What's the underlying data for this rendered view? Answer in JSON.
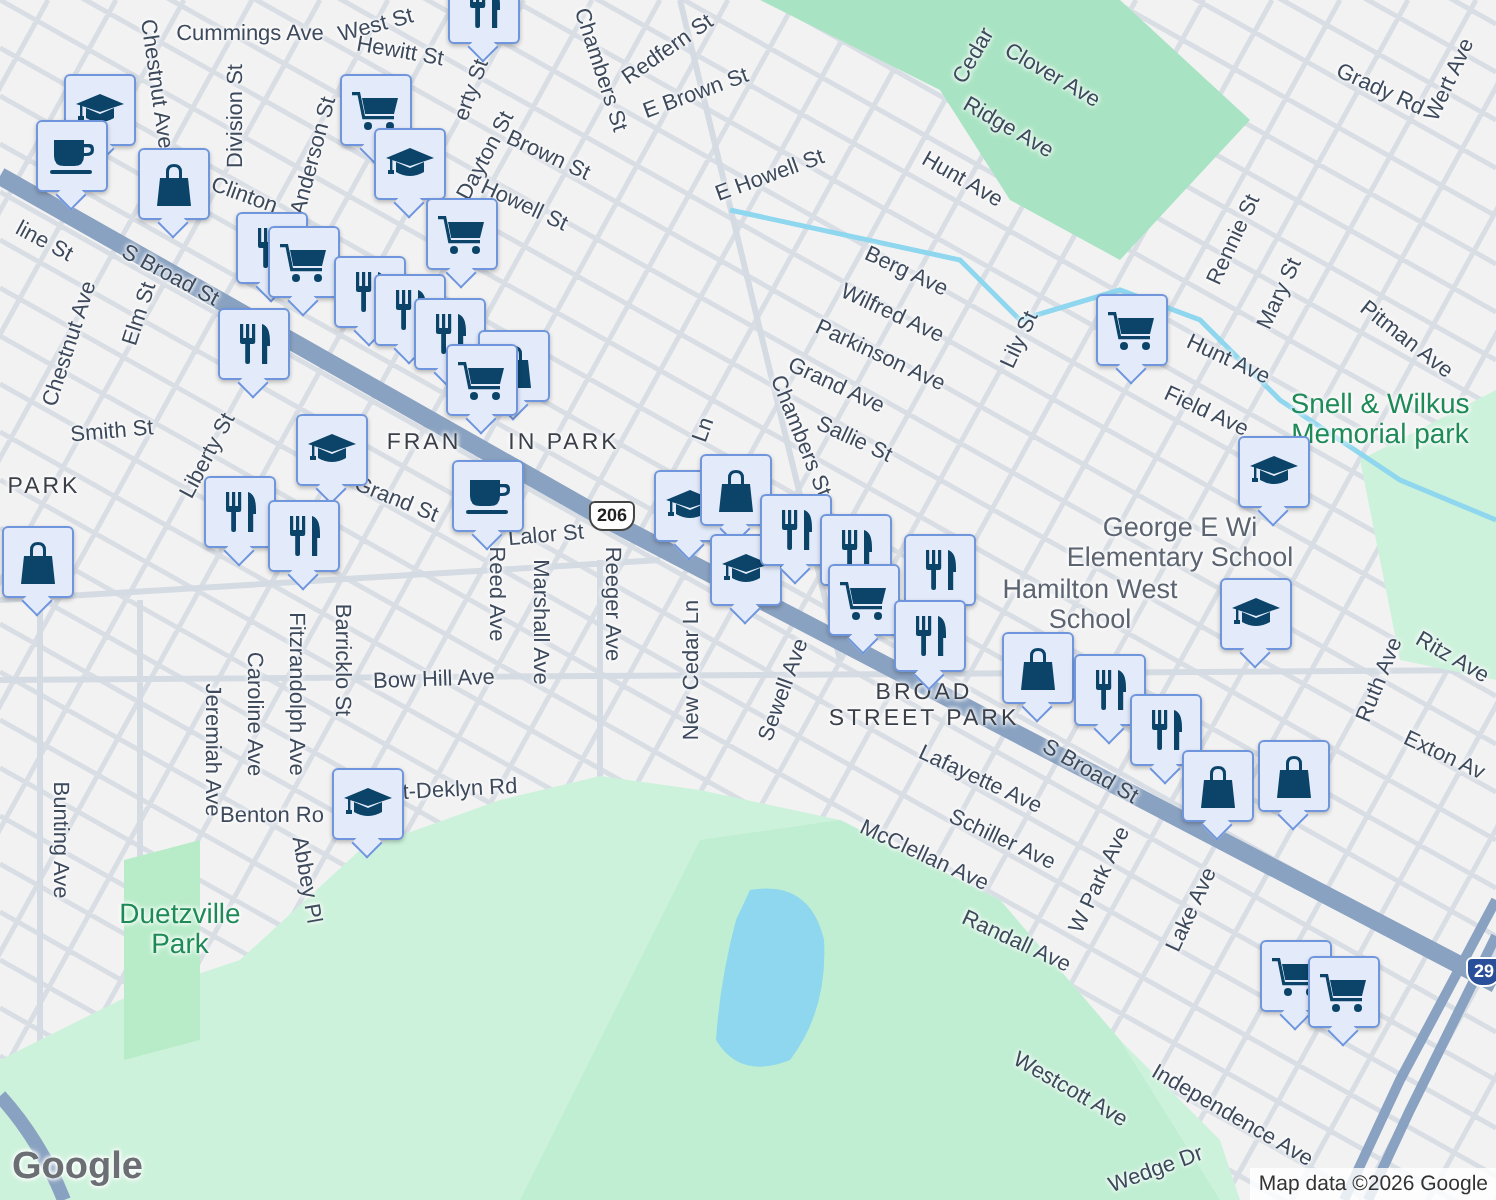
{
  "labels": [
    {
      "text": "Cummings Ave",
      "kind": "street"
    },
    {
      "text": "West St",
      "kind": "street"
    },
    {
      "text": "Chestnut Ave",
      "kind": "street"
    },
    {
      "text": "Division St",
      "kind": "street"
    },
    {
      "text": "Anderson St",
      "kind": "street"
    },
    {
      "text": "Hewitt St",
      "kind": "street"
    },
    {
      "text": "erty St",
      "kind": "street"
    },
    {
      "text": "Dayton St",
      "kind": "street"
    },
    {
      "text": "Brown St",
      "kind": "street"
    },
    {
      "text": "Howell St",
      "kind": "street"
    },
    {
      "text": "Clinton",
      "kind": "street"
    },
    {
      "text": "S Broad St",
      "kind": "street"
    },
    {
      "text": "Chambers St",
      "kind": "street"
    },
    {
      "text": "Redfern St",
      "kind": "street"
    },
    {
      "text": "E Brown St",
      "kind": "street"
    },
    {
      "text": "E Howell St",
      "kind": "street"
    },
    {
      "text": "line St",
      "kind": "street"
    },
    {
      "text": "Chestnut Ave",
      "kind": "street"
    },
    {
      "text": "Elm St",
      "kind": "street"
    },
    {
      "text": "Smith St",
      "kind": "street"
    },
    {
      "text": "Liberty St",
      "kind": "street"
    },
    {
      "text": "Grand St",
      "kind": "street"
    },
    {
      "text": "Lalor St",
      "kind": "street"
    },
    {
      "text": "Reed Ave",
      "kind": "street"
    },
    {
      "text": "Marshall Ave",
      "kind": "street"
    },
    {
      "text": "Reeger Ave",
      "kind": "street"
    },
    {
      "text": "New Cedar Ln",
      "kind": "street"
    },
    {
      "text": "Bow Hill Ave",
      "kind": "street"
    },
    {
      "text": "Barricklo St",
      "kind": "street"
    },
    {
      "text": "Fitzrandolph Ave",
      "kind": "street"
    },
    {
      "text": "Caroline Ave",
      "kind": "street"
    },
    {
      "text": "Jeremiah Ave",
      "kind": "street"
    },
    {
      "text": "Bunting Ave",
      "kind": "street"
    },
    {
      "text": "Benton Ro",
      "kind": "street"
    },
    {
      "text": "t-Deklyn Rd",
      "kind": "street"
    },
    {
      "text": "Abbey Pl",
      "kind": "street"
    },
    {
      "text": "Sewell Ave",
      "kind": "street"
    },
    {
      "text": "Lafayette Ave",
      "kind": "street"
    },
    {
      "text": "Schiller Ave",
      "kind": "street"
    },
    {
      "text": "McClellan Ave",
      "kind": "street"
    },
    {
      "text": "Randall Ave",
      "kind": "street"
    },
    {
      "text": "W Park Ave",
      "kind": "street"
    },
    {
      "text": "Lake Ave",
      "kind": "street"
    },
    {
      "text": "Westcott Ave",
      "kind": "street"
    },
    {
      "text": "Independence Ave",
      "kind": "street"
    },
    {
      "text": "Wedge Dr",
      "kind": "street"
    },
    {
      "text": "Ruth Ave",
      "kind": "street"
    },
    {
      "text": "Exton Av",
      "kind": "street"
    },
    {
      "text": "Ritz Ave",
      "kind": "street"
    },
    {
      "text": "S Broad St",
      "kind": "street"
    },
    {
      "text": "Chambers St",
      "kind": "street"
    },
    {
      "text": "Cedar",
      "kind": "street"
    },
    {
      "text": "Clover Ave",
      "kind": "street"
    },
    {
      "text": "Ridge Ave",
      "kind": "street"
    },
    {
      "text": "Hunt Ave",
      "kind": "street"
    },
    {
      "text": "Berg Ave",
      "kind": "street"
    },
    {
      "text": "Wilfred Ave",
      "kind": "street"
    },
    {
      "text": "Parkinson Ave",
      "kind": "street"
    },
    {
      "text": "Grand Ave",
      "kind": "street"
    },
    {
      "text": "Sallie St",
      "kind": "street"
    },
    {
      "text": "Lily St",
      "kind": "street"
    },
    {
      "text": "Rennie St",
      "kind": "street"
    },
    {
      "text": "Mary St",
      "kind": "street"
    },
    {
      "text": "Hunt Ave",
      "kind": "street"
    },
    {
      "text": "Field Ave",
      "kind": "street"
    },
    {
      "text": "Pitman Ave",
      "kind": "street"
    },
    {
      "text": "Grady Rd",
      "kind": "street"
    },
    {
      "text": "Wert Ave",
      "kind": "street"
    },
    {
      "text": "Ln",
      "kind": "street"
    },
    {
      "text": "FRAN",
      "kind": "area"
    },
    {
      "text": "IN PARK",
      "kind": "area"
    },
    {
      "text": "PARK",
      "kind": "area"
    },
    {
      "text": "BROAD STREET PARK",
      "kind": "area"
    },
    {
      "text": "Duetzville Park",
      "kind": "park"
    },
    {
      "text": "Snell & Wilkus Memorial park",
      "kind": "park"
    },
    {
      "text": "George E Wi Elementary School",
      "kind": "poi"
    },
    {
      "text": "Hamilton West School",
      "kind": "poi"
    }
  ],
  "pins": [
    {
      "kind": "restaurant"
    },
    {
      "kind": "school"
    },
    {
      "kind": "cafe"
    },
    {
      "kind": "bag"
    },
    {
      "kind": "cart"
    },
    {
      "kind": "school"
    },
    {
      "kind": "restaurant"
    },
    {
      "kind": "cart"
    },
    {
      "kind": "cart"
    },
    {
      "kind": "restaurant"
    },
    {
      "kind": "restaurant"
    },
    {
      "kind": "restaurant"
    },
    {
      "kind": "restaurant"
    },
    {
      "kind": "bag"
    },
    {
      "kind": "cart"
    },
    {
      "kind": "school"
    },
    {
      "kind": "cafe"
    },
    {
      "kind": "restaurant"
    },
    {
      "kind": "restaurant"
    },
    {
      "kind": "bag"
    },
    {
      "kind": "school"
    },
    {
      "kind": "bag"
    },
    {
      "kind": "school"
    },
    {
      "kind": "restaurant"
    },
    {
      "kind": "restaurant"
    },
    {
      "kind": "cart"
    },
    {
      "kind": "restaurant"
    },
    {
      "kind": "restaurant"
    },
    {
      "kind": "cart"
    },
    {
      "kind": "school"
    },
    {
      "kind": "school"
    },
    {
      "kind": "bag"
    },
    {
      "kind": "restaurant"
    },
    {
      "kind": "restaurant"
    },
    {
      "kind": "bag"
    },
    {
      "kind": "bag"
    },
    {
      "kind": "cart"
    },
    {
      "kind": "cart"
    },
    {
      "kind": "school"
    }
  ],
  "shields": [
    {
      "text": "206",
      "kind": "us-route"
    },
    {
      "text": "29",
      "kind": "interstate"
    }
  ],
  "logo": "Google",
  "attribution": "Map data ©2026 Google"
}
